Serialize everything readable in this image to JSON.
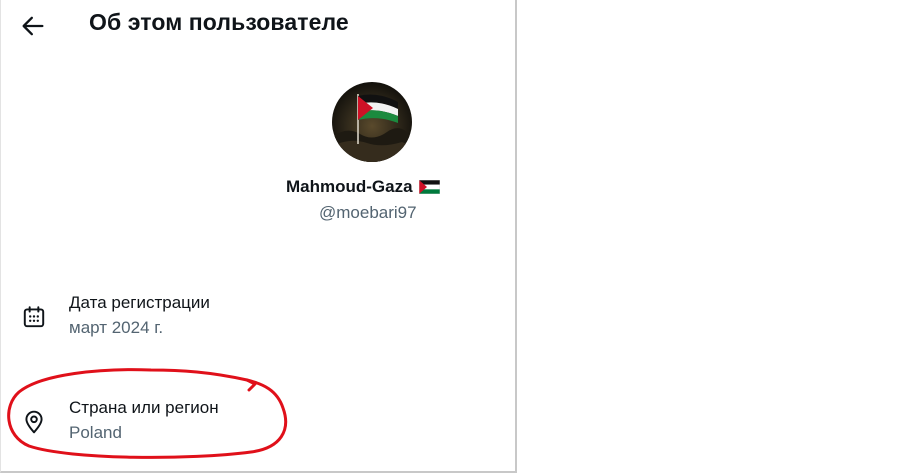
{
  "header": {
    "title": "Об этом пользователе",
    "back_icon": "arrow-left-icon"
  },
  "profile": {
    "display_name": "Mahmoud-Gaza",
    "handle": "@moebari97",
    "name_flag_icon": "palestine-flag-icon",
    "avatar_icon": "palestine-flag-avatar"
  },
  "details": {
    "registration": {
      "icon": "calendar-icon",
      "label": "Дата регистрации",
      "value": "март 2024 г."
    },
    "country": {
      "icon": "location-pin-icon",
      "label": "Страна или регион",
      "value": "Poland"
    }
  },
  "colors": {
    "text_primary": "#0f1419",
    "text_secondary": "#536471",
    "annotation": "#e0101a",
    "flag_red": "#ce1126",
    "flag_green": "#007a3d"
  }
}
